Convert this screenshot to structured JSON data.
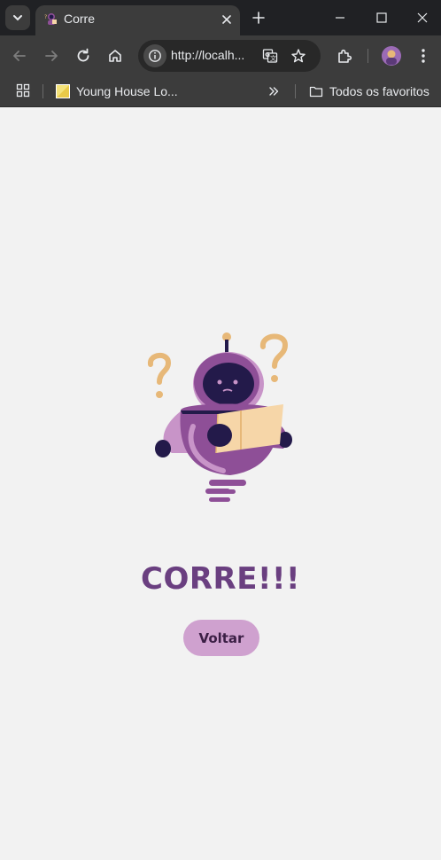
{
  "browser": {
    "tab": {
      "title": "Corre"
    },
    "address_bar": {
      "url": "http://localh..."
    },
    "bookmarks": {
      "items": [
        {
          "label": "Young House Lo..."
        }
      ],
      "all_bookmarks_label": "Todos os favoritos"
    }
  },
  "page": {
    "headline": "CORRE!!!",
    "back_button_label": "Voltar"
  },
  "colors": {
    "page_background": "#f2f2f2",
    "headline": "#6a3f80",
    "button_background": "#cfa1cf",
    "button_text": "#3b1f45",
    "robot_body": "#8e4f97",
    "robot_face": "#231a4a",
    "question_marks": "#e7b878",
    "map": "#f6d6a8"
  },
  "icons": {
    "tabstrip": [
      "tab-search-icon",
      "favicon-icon",
      "close-icon",
      "new-tab-icon",
      "minimize-icon",
      "maximize-icon",
      "window-close-icon"
    ],
    "toolbar": [
      "back-arrow-icon",
      "forward-arrow-icon",
      "reload-icon",
      "home-icon",
      "site-info-icon",
      "translate-icon",
      "star-icon",
      "extensions-icon",
      "profile-avatar",
      "menu-dots-icon"
    ],
    "bookmarks": [
      "apps-grid-icon",
      "bookmark-favicon",
      "chevron-double-icon",
      "folder-icon"
    ],
    "page": [
      "confused-robot-illustration"
    ]
  }
}
